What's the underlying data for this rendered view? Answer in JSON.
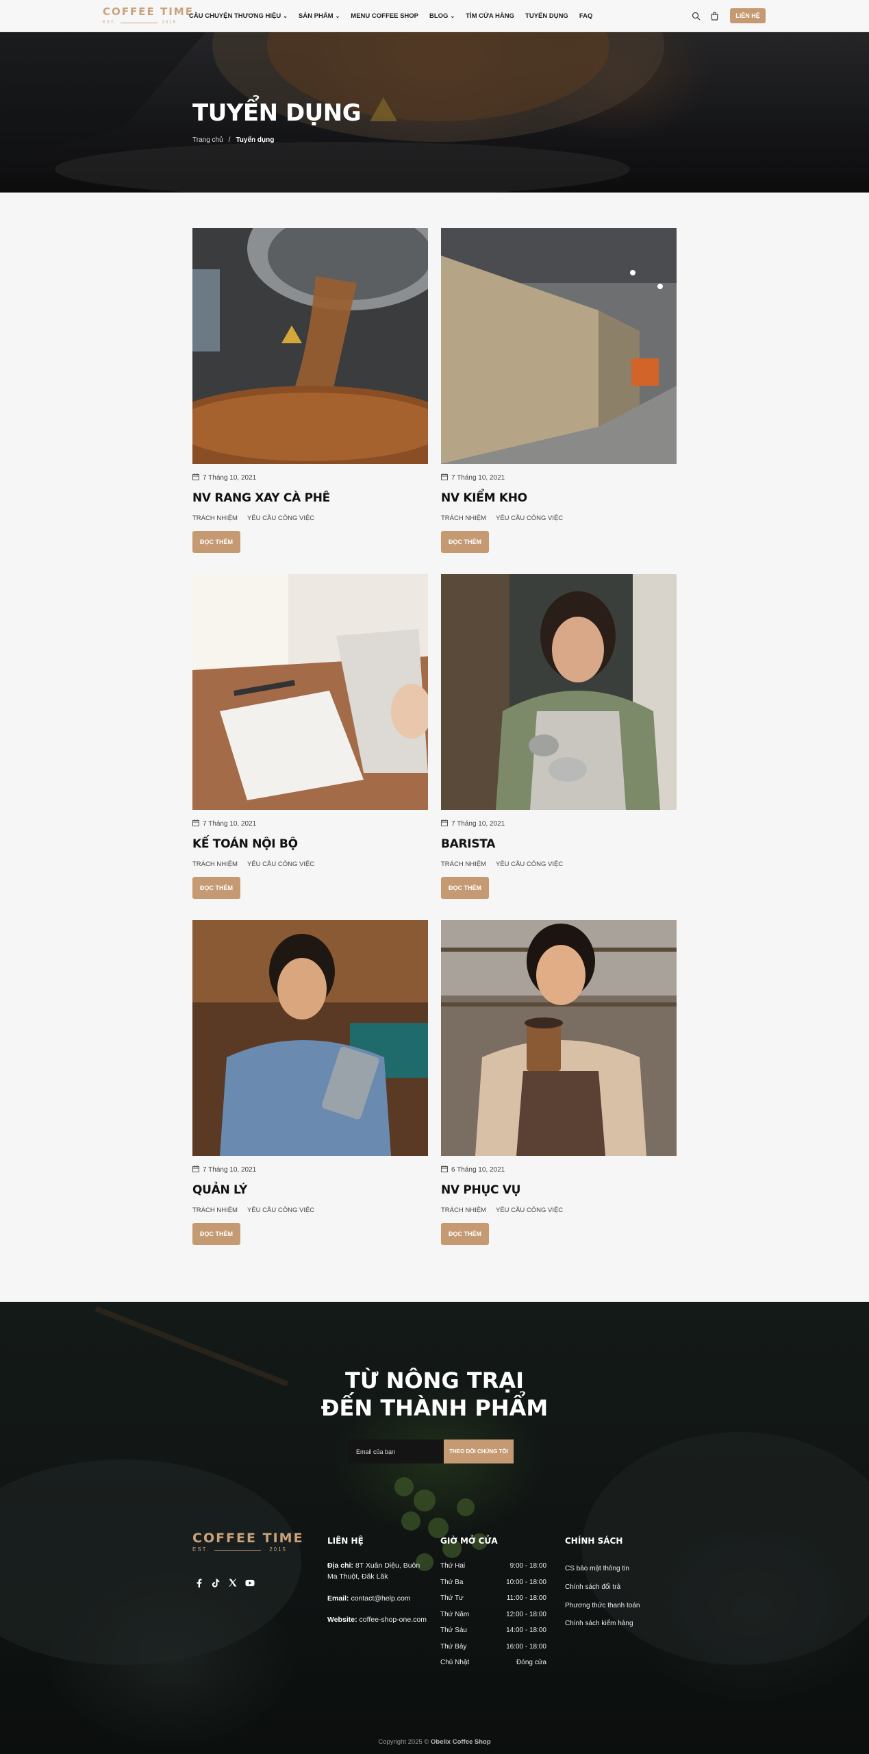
{
  "header": {
    "logo_main": "COFFEE TIME",
    "logo_est": "EST.",
    "logo_year": "2015",
    "nav": [
      {
        "label": "Câu chuyện thương hiệu",
        "has_dropdown": true
      },
      {
        "label": "Sản phẩm",
        "has_dropdown": true
      },
      {
        "label": "Menu Coffee Shop",
        "has_dropdown": false
      },
      {
        "label": "Blog",
        "has_dropdown": true
      },
      {
        "label": "Tìm cửa hàng",
        "has_dropdown": false
      },
      {
        "label": "Tuyển dụng",
        "has_dropdown": false
      },
      {
        "label": "FAQ",
        "has_dropdown": false
      }
    ],
    "contact_button": "LIÊN HỆ",
    "icons": [
      "search-icon",
      "cart-icon"
    ]
  },
  "hero": {
    "title": "TUYỂN DỤNG",
    "breadcrumb_home": "Trang chủ",
    "breadcrumb_sep": "/",
    "breadcrumb_current": "Tuyển dụng"
  },
  "jobs": [
    {
      "date": "7 Tháng 10, 2021",
      "title": "NV RANG XAY CÀ PHÊ",
      "tag1": "TRÁCH NHIỆM",
      "tag2": "YÊU CẦU CÔNG VIỆC",
      "button": "ĐỌC THÊM",
      "image": "coffee-roaster-photo"
    },
    {
      "date": "7 Tháng 10, 2021",
      "title": "NV KIỂM KHO",
      "tag1": "TRÁCH NHIỆM",
      "tag2": "YÊU CẦU CÔNG VIỆC",
      "button": "ĐỌC THÊM",
      "image": "warehouse-photo"
    },
    {
      "date": "7 Tháng 10, 2021",
      "title": "KẾ TOÁN NỘI BỘ",
      "tag1": "TRÁCH NHIỆM",
      "tag2": "YÊU CẦU CÔNG VIỆC",
      "button": "ĐỌC THÊM",
      "image": "notebook-photo"
    },
    {
      "date": "7 Tháng 10, 2021",
      "title": "BARISTA",
      "tag1": "TRÁCH NHIỆM",
      "tag2": "YÊU CẦU CÔNG VIỆC",
      "button": "ĐỌC THÊM",
      "image": "barista-photo"
    },
    {
      "date": "7 Tháng 10, 2021",
      "title": "QUẢN LÝ",
      "tag1": "TRÁCH NHIỆM",
      "tag2": "YÊU CẦU CÔNG VIỆC",
      "button": "ĐỌC THÊM",
      "image": "manager-photo"
    },
    {
      "date": "6 Tháng 10, 2021",
      "title": "NV PHỤC VỤ",
      "tag1": "TRÁCH NHIỆM",
      "tag2": "YÊU CẦU CÔNG VIỆC",
      "button": "ĐỌC THÊM",
      "image": "server-photo"
    }
  ],
  "footer": {
    "heading_line1": "TỪ NÔNG TRẠI",
    "heading_line2": "ĐẾN THÀNH PHẨM",
    "email_placeholder": "Email của bạn",
    "subscribe_button": "THEO DÕI CHÚNG TÔI",
    "logo_main": "COFFEE TIME",
    "logo_est": "EST.",
    "logo_year": "2015",
    "social": [
      "facebook-icon",
      "tiktok-icon",
      "x-icon",
      "youtube-icon"
    ],
    "contact_title": "LIÊN HỆ",
    "address_label": "Địa chỉ:",
    "address_line1": "8T Xuân Diệu, Buôn",
    "address_line2": "Ma Thuột, Đăk Lăk",
    "email_label": "Email:",
    "email_value": "contact@help.com",
    "website_label": "Website:",
    "website_value": "coffee-shop-one.com",
    "hours_title": "GIỜ MỞ CỬA",
    "hours": [
      {
        "day": "Thứ Hai",
        "time": "9:00 - 18:00"
      },
      {
        "day": "Thứ Ba",
        "time": "10:00 - 18:00"
      },
      {
        "day": "Thứ Tư",
        "time": "11:00 - 18:00"
      },
      {
        "day": "Thứ Năm",
        "time": "12:00 - 18:00"
      },
      {
        "day": "Thứ Sáu",
        "time": "14:00 - 18:00"
      },
      {
        "day": "Thứ Bảy",
        "time": "16:00 - 18:00"
      },
      {
        "day": "Chủ Nhật",
        "time": "Đóng cửa"
      }
    ],
    "policy_title": "CHÍNH SÁCH",
    "policies": [
      "CS bảo mật thông tin",
      "Chính sách đổi trả",
      "Phương thức thanh toán",
      "Chính sách kiểm hàng"
    ],
    "copyright_prefix": "Copyright 2025 ©",
    "copyright_brand": "Obelix Coffee Shop"
  },
  "colors": {
    "accent": "#c59a72",
    "footer_bg": "#151b19",
    "page_bg": "#f6f6f6"
  }
}
